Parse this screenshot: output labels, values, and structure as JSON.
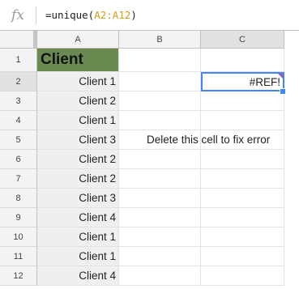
{
  "formula_bar": {
    "fx": "fx",
    "prefix": "=unique(",
    "range": "A2:A12",
    "suffix": ")"
  },
  "columns": [
    "A",
    "B",
    "C"
  ],
  "rows": [
    "1",
    "2",
    "3",
    "4",
    "5",
    "6",
    "7",
    "8",
    "9",
    "10",
    "11",
    "12"
  ],
  "cells": {
    "A1": "Client",
    "A": [
      "Client 1",
      "Client 2",
      "Client 1",
      "Client 3",
      "Client 2",
      "Client 2",
      "Client 3",
      "Client 4",
      "Client 1",
      "Client 1",
      "Client 4"
    ],
    "C2": "#REF!",
    "B5": "Delete this cell to fix error"
  },
  "colors": {
    "header_fill": "#6a8a52",
    "selection": "#4285f4",
    "error_marker": "#9b59b6",
    "range_highlight": "#d59b1a"
  }
}
